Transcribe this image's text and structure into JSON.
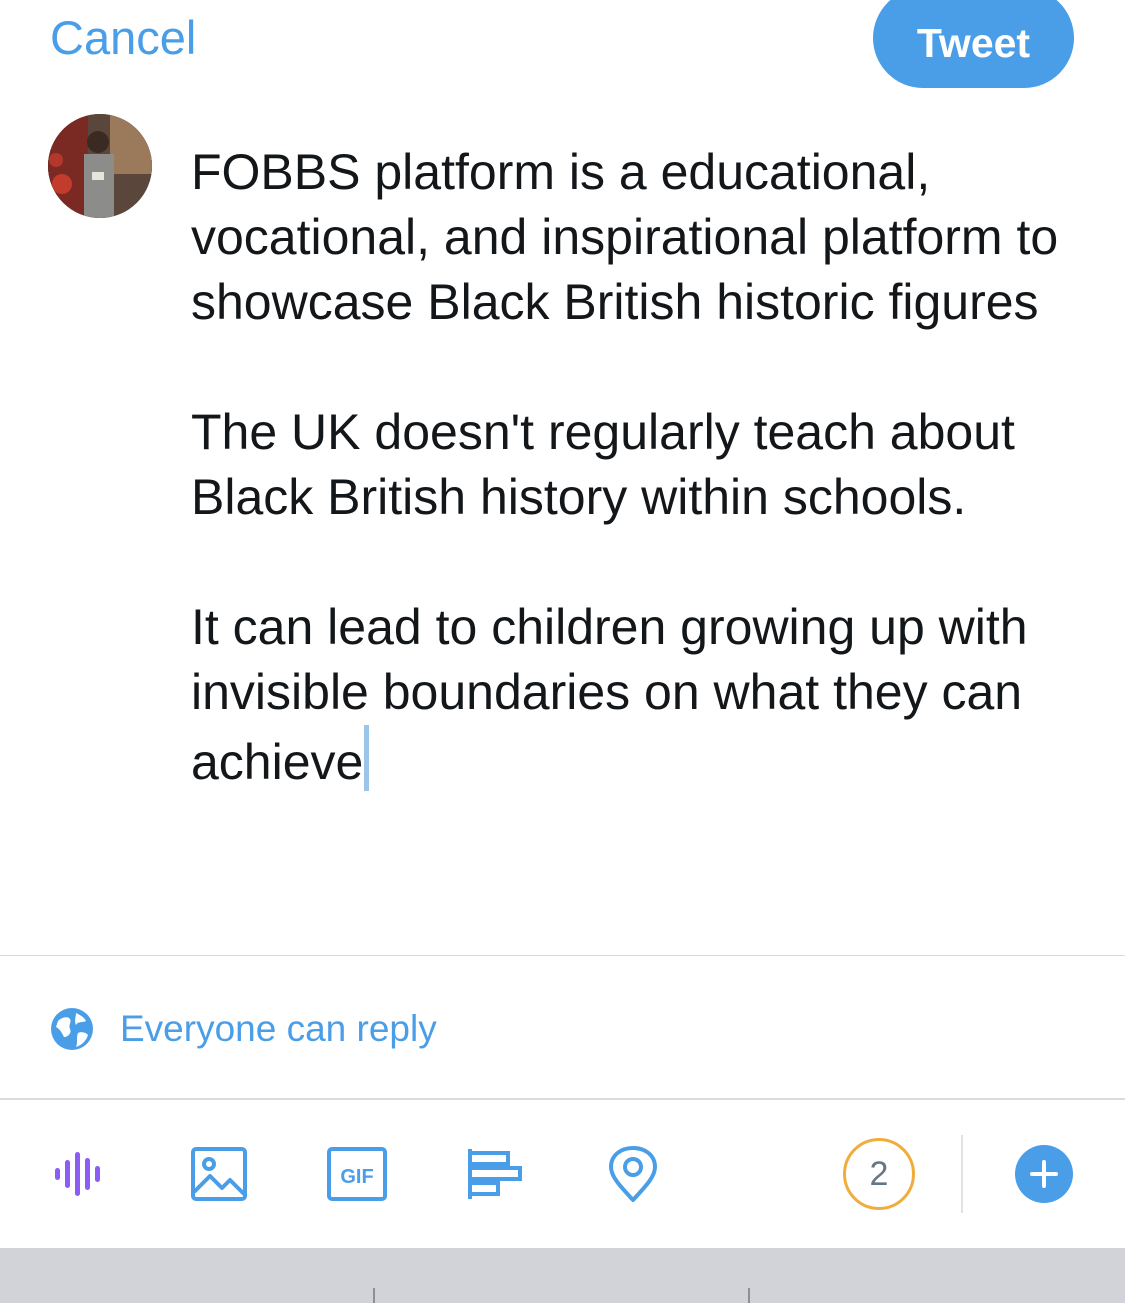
{
  "header": {
    "cancel_label": "Cancel",
    "tweet_label": "Tweet"
  },
  "compose": {
    "paragraphs": [
      "FOBBS platform is a educational, vocational, and inspirational platform to showcase Black British historic figures",
      "The UK doesn't regularly teach about Black British history within schools.",
      "It can lead to children growing up with invisible boundaries on what they can achieve"
    ]
  },
  "reply_setting": {
    "label": "Everyone can reply",
    "icon": "globe-icon"
  },
  "toolbar": {
    "icons": [
      "audio-space-icon",
      "image-icon",
      "gif-icon",
      "poll-icon",
      "location-icon",
      "add-icon"
    ],
    "remaining_count": "2"
  },
  "colors": {
    "accent": "#4a9ee8",
    "counter_ring": "#f0ad3c",
    "spaces_purple": "#8b5cf6"
  }
}
